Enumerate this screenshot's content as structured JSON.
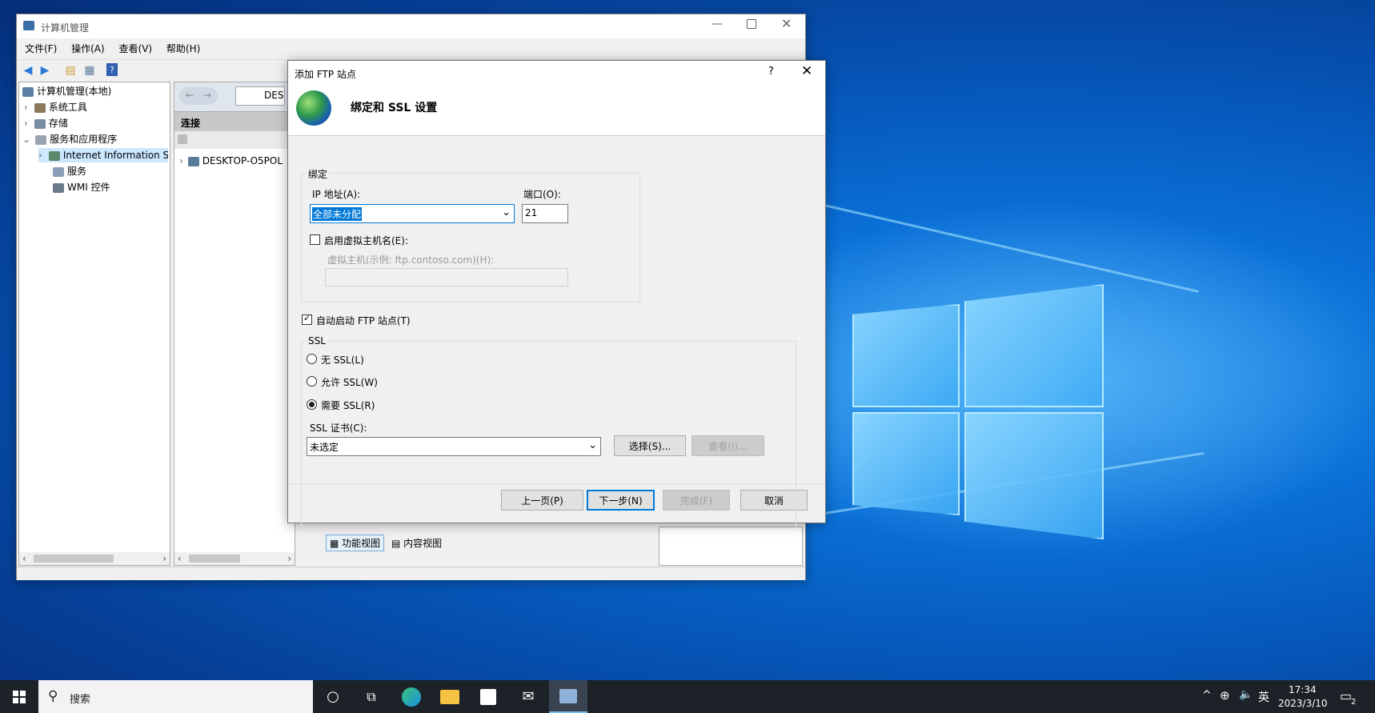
{
  "main_window": {
    "title": "计算机管理",
    "menu": [
      "文件(F)",
      "操作(A)",
      "查看(V)",
      "帮助(H)"
    ],
    "tree": [
      {
        "label": "计算机管理(本地)",
        "level": 0
      },
      {
        "label": "系统工具",
        "level": 1
      },
      {
        "label": "存储",
        "level": 1
      },
      {
        "label": "服务和应用程序",
        "level": 1
      },
      {
        "label": "Internet Information S",
        "level": 2
      },
      {
        "label": "服务",
        "level": 2
      },
      {
        "label": "WMI 控件",
        "level": 2
      }
    ],
    "address_text": "DES",
    "connections_header": "连接",
    "connection_item": "DESKTOP-O5POL",
    "view_tabs": [
      "功能视图",
      "内容视图"
    ]
  },
  "dialog": {
    "title": "添加 FTP 站点",
    "help": "?",
    "heading": "绑定和 SSL 设置",
    "binding_group": "绑定",
    "ip_label": "IP 地址(A):",
    "ip_value": "全部未分配",
    "port_label": "端口(O):",
    "port_value": "21",
    "virtual_host_check": "启用虚拟主机名(E):",
    "virtual_host_label": "虚拟主机(示例: ftp.contoso.com)(H):",
    "virtual_host_value": "",
    "autostart_check": "自动启动 FTP 站点(T)",
    "ssl_group": "SSL",
    "ssl_options": [
      "无 SSL(L)",
      "允许 SSL(W)",
      "需要 SSL(R)"
    ],
    "ssl_selected": 2,
    "cert_label": "SSL 证书(C):",
    "cert_value": "未选定",
    "select_button": "选择(S)...",
    "view_button": "查看(I)...",
    "prev_button": "上一页(P)",
    "next_button": "下一步(N)",
    "finish_button": "完成(F)",
    "cancel_button": "取消"
  },
  "taskbar": {
    "search_placeholder": "搜索",
    "ime": "英",
    "time": "17:34",
    "date": "2023/3/10",
    "notification_count": "2"
  }
}
